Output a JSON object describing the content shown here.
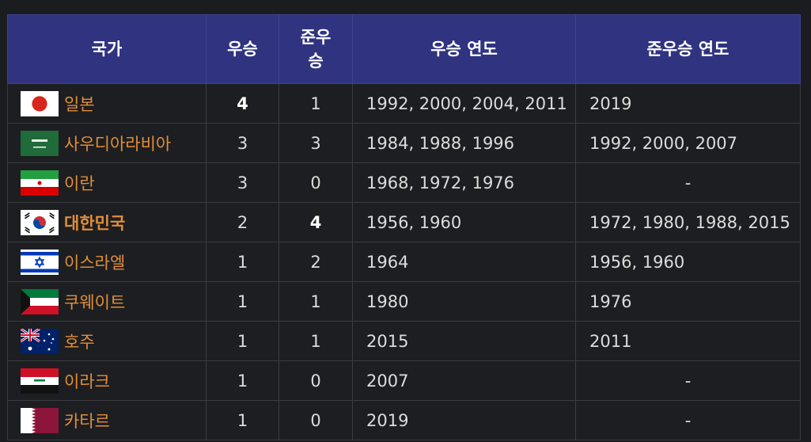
{
  "headers": {
    "country": "국가",
    "wins": "우승",
    "runner_up": "준우승",
    "win_years": "우승 연도",
    "runner_up_years": "준우승 연도"
  },
  "rows": [
    {
      "flag": "japan-flag-icon",
      "country": "일본",
      "wins": "4",
      "runner_up": "1",
      "win_years": "1992, 2000, 2004, 2011",
      "runner_up_years": "2019"
    },
    {
      "flag": "saudi-arabia-flag-icon",
      "country": "사우디아라비아",
      "wins": "3",
      "runner_up": "3",
      "win_years": "1984, 1988, 1996",
      "runner_up_years": "1992, 2000, 2007"
    },
    {
      "flag": "iran-flag-icon",
      "country": "이란",
      "wins": "3",
      "runner_up": "0",
      "win_years": "1968, 1972, 1976",
      "runner_up_years": "-"
    },
    {
      "flag": "south-korea-flag-icon",
      "country": "대한민국",
      "wins": "2",
      "runner_up": "4",
      "win_years": "1956, 1960",
      "runner_up_years": "1972, 1980, 1988, 2015"
    },
    {
      "flag": "israel-flag-icon",
      "country": "이스라엘",
      "wins": "1",
      "runner_up": "2",
      "win_years": "1964",
      "runner_up_years": "1956, 1960"
    },
    {
      "flag": "kuwait-flag-icon",
      "country": "쿠웨이트",
      "wins": "1",
      "runner_up": "1",
      "win_years": "1980",
      "runner_up_years": "1976"
    },
    {
      "flag": "australia-flag-icon",
      "country": "호주",
      "wins": "1",
      "runner_up": "1",
      "win_years": "2015",
      "runner_up_years": "2011"
    },
    {
      "flag": "iraq-flag-icon",
      "country": "이라크",
      "wins": "1",
      "runner_up": "0",
      "win_years": "2007",
      "runner_up_years": "-"
    },
    {
      "flag": "qatar-flag-icon",
      "country": "카타르",
      "wins": "1",
      "runner_up": "0",
      "win_years": "2019",
      "runner_up_years": "-"
    }
  ],
  "colors": {
    "header_bg": "#2f3380",
    "country_link": "#e08e3a",
    "cell_text": "#dcdcdc",
    "page_bg": "#1b1c1f"
  }
}
